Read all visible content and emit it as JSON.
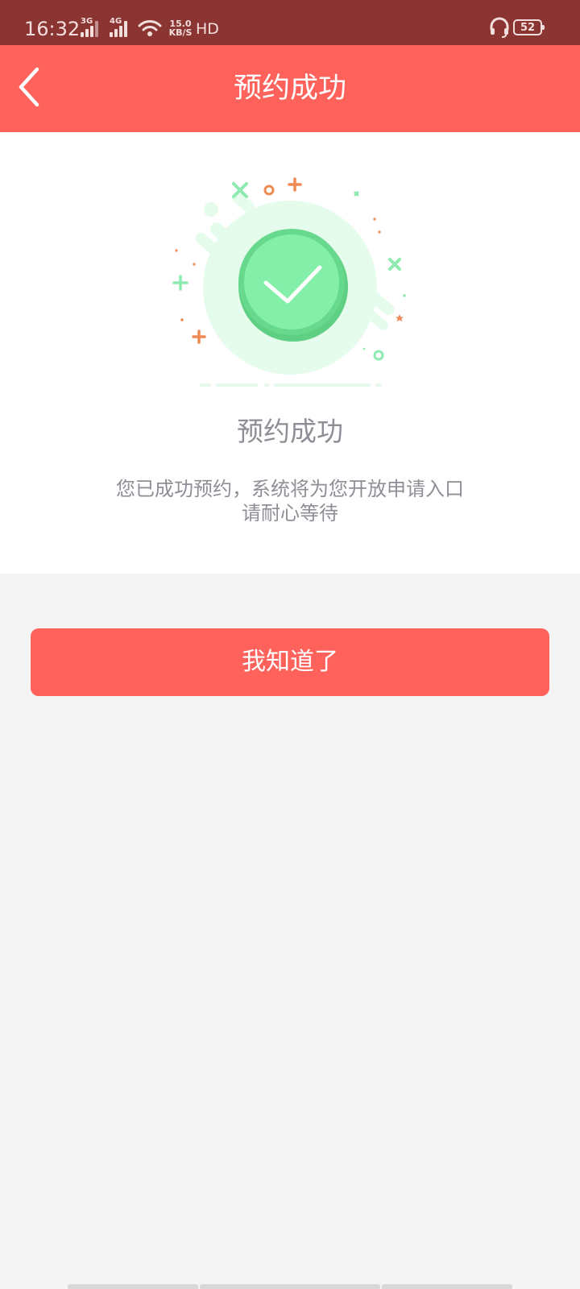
{
  "status_bar": {
    "time": "16:32",
    "network_1": "3G",
    "network_2": "4G",
    "speed_value": "15.0",
    "speed_unit": "KB/S",
    "hd_label": "HD",
    "battery": "52",
    "icons": [
      "signal-icon",
      "wifi-icon",
      "headset-icon",
      "battery-icon"
    ],
    "color": "#8b3532"
  },
  "header": {
    "title": "预约成功",
    "back_icon": "chevron-left-icon",
    "color": "#fe625b"
  },
  "result": {
    "icon": "check-circle-icon",
    "title": "预约成功",
    "description_line1": "您已成功预约，系统将为您开放申请入口",
    "description_line2": "请耐心等待",
    "accent": "#7ee9a5"
  },
  "actions": {
    "confirm_label": "我知道了",
    "color": "#fe625b"
  }
}
